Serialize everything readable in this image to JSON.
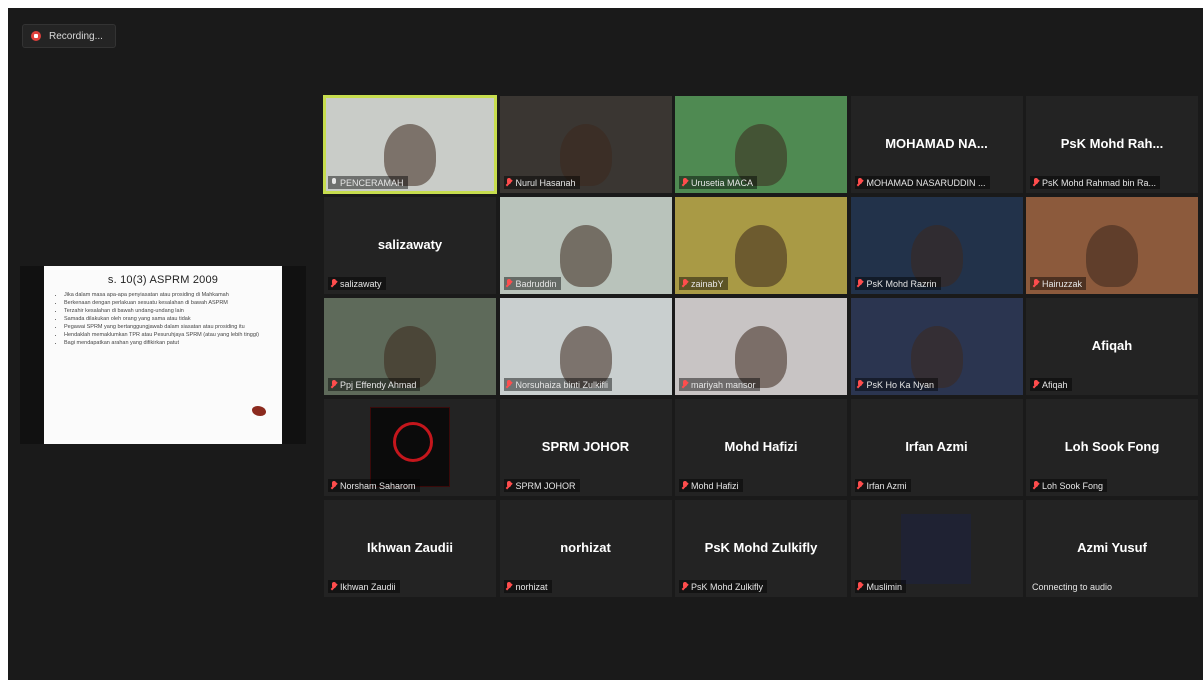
{
  "recording": {
    "label": "Recording..."
  },
  "slide": {
    "title": "s. 10(3) ASPRM 2009",
    "bullets": [
      "Jika dalam masa apa-apa penyiasatan atau prosiding di Mahkamah",
      "Berkenaan dengan perlakuan sesuatu kesalahan di bawah ASPRM",
      "Terzahir kesalahan di bawah undang-undang lain",
      "Samada dilakukan oleh orang yang sama atau tidak",
      "Pegawai SPRM yang bertanggungjawab dalam siasatan atau prosiding itu",
      "Hendaklah memaklumkan TPR atau Pesuruhjaya SPRM (atau yang lebih tinggi)",
      "Bagi mendapatkan arahan yang difikirkan patut"
    ]
  },
  "participants": [
    {
      "label": "PENCERAMAH",
      "video": true,
      "active": true,
      "muted": false,
      "bg": "#c9ccc8"
    },
    {
      "label": "Nurul Hasanah",
      "video": true,
      "muted": true,
      "bg": "#3a3632"
    },
    {
      "label": "Urusetia MACA",
      "video": true,
      "muted": true,
      "bg": "#4f8a52"
    },
    {
      "label": "MOHAMAD NASARUDDIN ...",
      "big": "MOHAMAD NA...",
      "video": false,
      "muted": true
    },
    {
      "label": "PsK Mohd Rahmad bin Ra...",
      "big": "PsK Mohd Rah...",
      "video": false,
      "muted": true
    },
    {
      "label": "salizawaty",
      "big": "salizawaty",
      "video": false,
      "muted": true
    },
    {
      "label": "Badruddin",
      "video": true,
      "muted": true,
      "bg": "#b9c3bb"
    },
    {
      "label": "zainabY",
      "video": true,
      "muted": true,
      "bg": "#a99a45"
    },
    {
      "label": "PsK Mohd Razrin",
      "video": true,
      "muted": true,
      "bg": "#22324a"
    },
    {
      "label": "Hairuzzak",
      "video": true,
      "muted": true,
      "bg": "#8c5a3c"
    },
    {
      "label": "Ppj Effendy Ahmad",
      "video": true,
      "muted": true,
      "bg": "#5e6a5a"
    },
    {
      "label": "Norsuhaiza binti Zulkifli",
      "video": true,
      "muted": true,
      "bg": "#c9cfcf"
    },
    {
      "label": "mariyah mansor",
      "video": true,
      "muted": true,
      "bg": "#c8c4c4"
    },
    {
      "label": "PsK Ho Ka Nyan",
      "video": true,
      "muted": true,
      "bg": "#2b3550"
    },
    {
      "label": "Afiqah",
      "big": "Afiqah",
      "video": false,
      "muted": true
    },
    {
      "label": "Norsham Saharom",
      "video": true,
      "logo": true,
      "muted": true,
      "bg": "#232323"
    },
    {
      "label": "SPRM JOHOR",
      "big": "SPRM JOHOR",
      "video": false,
      "muted": true
    },
    {
      "label": "Mohd Hafizi",
      "big": "Mohd Hafizi",
      "video": false,
      "muted": true
    },
    {
      "label": "Irfan Azmi",
      "big": "Irfan Azmi",
      "video": false,
      "muted": true
    },
    {
      "label": "Loh Sook Fong",
      "big": "Loh Sook Fong",
      "video": false,
      "muted": true
    },
    {
      "label": "Ikhwan Zaudii",
      "big": "Ikhwan Zaudii",
      "video": false,
      "muted": true
    },
    {
      "label": "norhizat",
      "big": "norhizat",
      "video": false,
      "muted": true
    },
    {
      "label": "PsK Mohd Zulkifly",
      "big": "PsK Mohd Zulkifly",
      "video": false,
      "muted": true
    },
    {
      "label": "Muslimin",
      "video": true,
      "muted": true,
      "bg": "#232323",
      "inset": true
    },
    {
      "label": "Connecting to audio",
      "big": "Azmi Yusuf",
      "video": false,
      "muted": false,
      "connecting": true
    }
  ]
}
